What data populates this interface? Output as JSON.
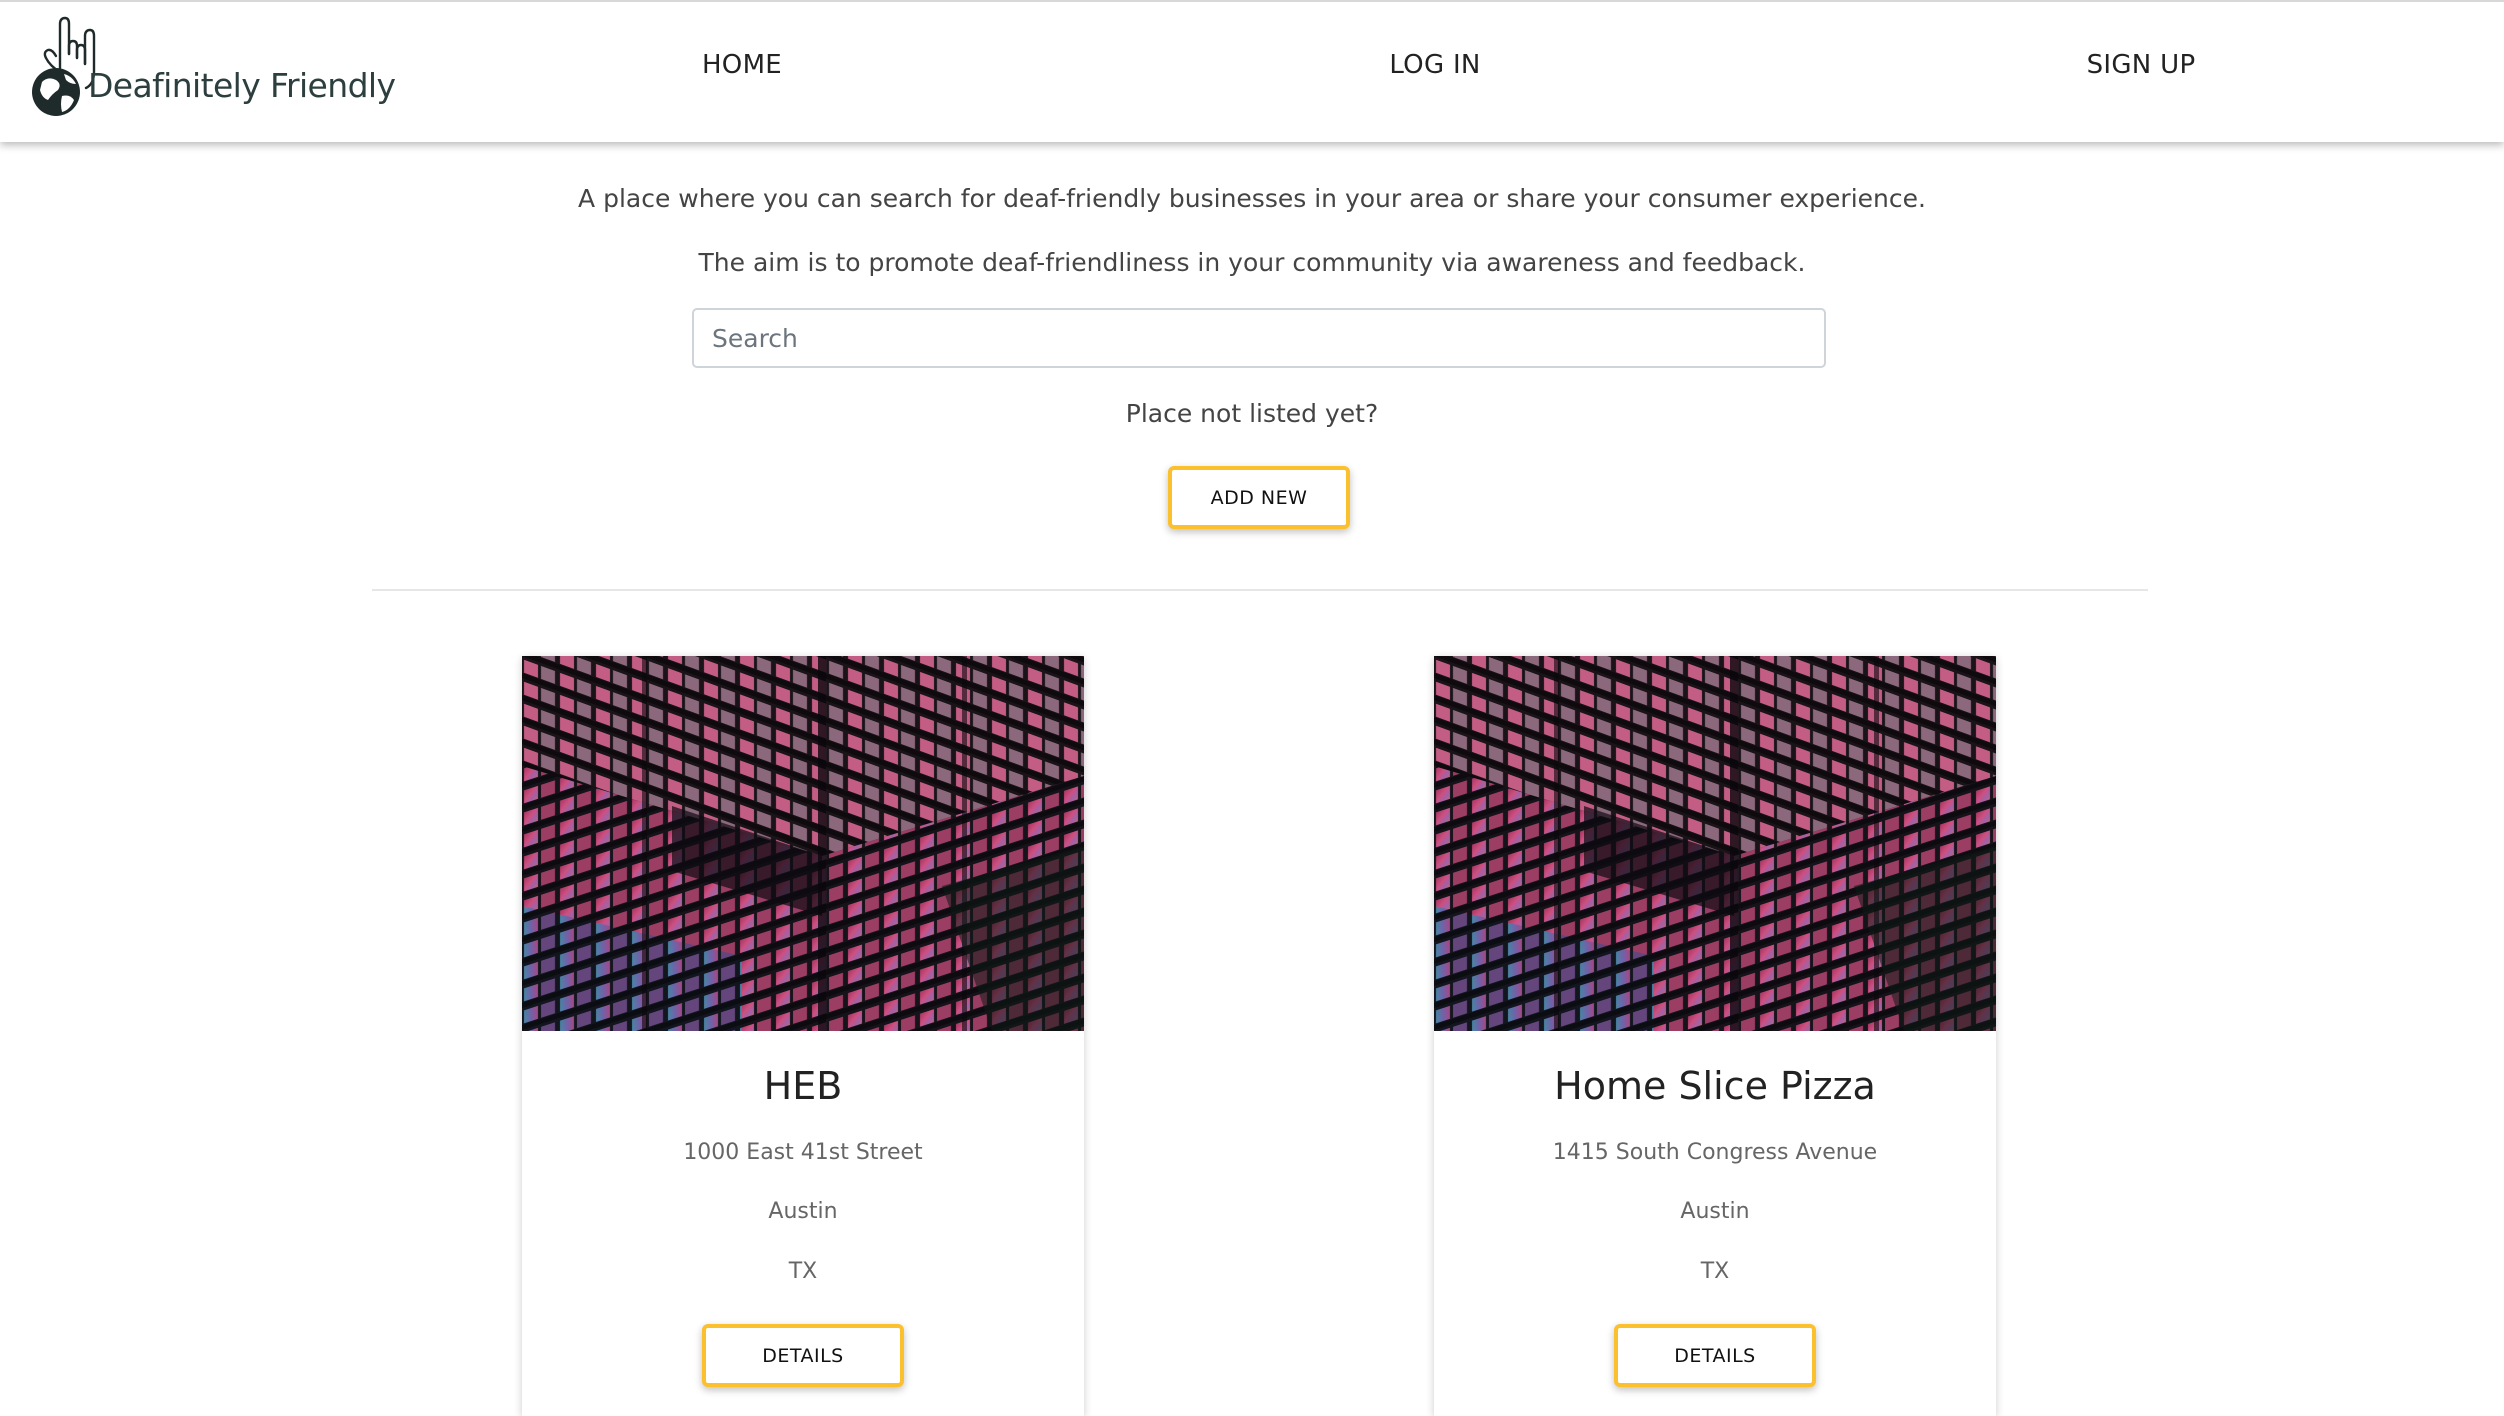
{
  "nav": {
    "logo_text": "Deafinitely Friendly",
    "links": [
      "HOME",
      "LOG IN",
      "SIGN UP"
    ]
  },
  "intro": {
    "line1": "A place where you can search for deaf-friendly businesses in your area or share your consumer experience.",
    "line2": "The aim is to promote deaf-friendliness in your community via awareness and feedback."
  },
  "search": {
    "placeholder": "Search",
    "value": ""
  },
  "add_prompt": "Place not listed yet?",
  "add_button": "ADD NEW",
  "places": [
    {
      "name": "HEB",
      "street": "1000 East 41st Street",
      "city": "Austin",
      "state": "TX",
      "button": "DETAILS"
    },
    {
      "name": "Home Slice Pizza",
      "street": "1415 South Congress Avenue",
      "city": "Austin",
      "state": "TX",
      "button": "DETAILS"
    }
  ],
  "colors": {
    "accent": "#fbc02d",
    "text": "#333333",
    "muted": "#666666"
  }
}
